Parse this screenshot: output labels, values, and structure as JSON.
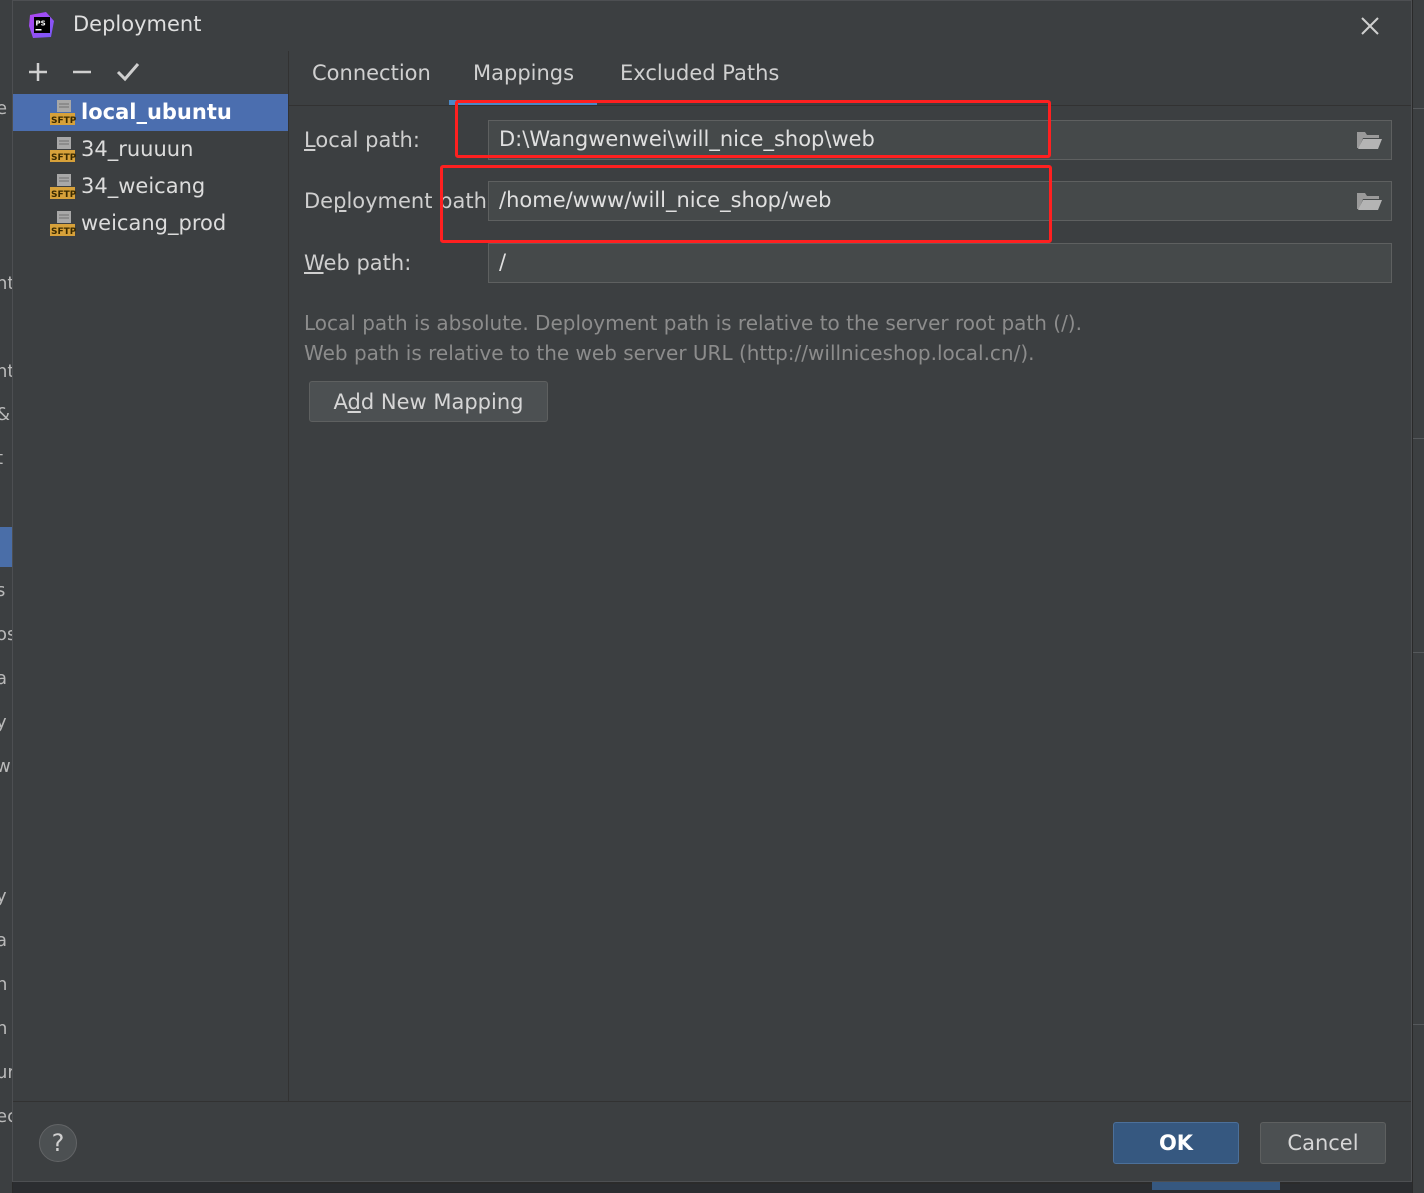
{
  "window": {
    "title": "Deployment",
    "app_icon_text": "PS"
  },
  "background_left_chars": [
    "e c",
    "nt",
    "nt",
    "&",
    "t",
    "s",
    "os",
    "a",
    "y",
    "w",
    "y",
    "a",
    "n",
    "n",
    "ur",
    "ec"
  ],
  "toolbar": {
    "add_icon": "plus-icon",
    "remove_icon": "minus-icon",
    "apply_icon": "check-icon"
  },
  "servers": [
    {
      "name": "local_ubuntu",
      "icon": "sftp-server-icon",
      "selected": true
    },
    {
      "name": "34_ruuuun",
      "icon": "sftp-server-icon",
      "selected": false
    },
    {
      "name": "34_weicang",
      "icon": "sftp-server-icon",
      "selected": false
    },
    {
      "name": "weicang_prod",
      "icon": "sftp-server-icon",
      "selected": false
    }
  ],
  "sftp_badge": "SFTP",
  "tabs": [
    {
      "label": "Connection",
      "active": false
    },
    {
      "label": "Mappings",
      "active": true
    },
    {
      "label": "Excluded Paths",
      "active": false
    }
  ],
  "mapping": {
    "local_path_label_mn": "L",
    "local_path_label_rest": "ocal path:",
    "local_path_value": "D:\\Wangwenwei\\will_nice_shop\\web",
    "deployment_path_label_pre": "De",
    "deployment_path_label_mn": "p",
    "deployment_path_label_rest": "loyment path:",
    "deployment_path_value": "/home/www/will_nice_shop/web",
    "web_path_label_mn": "W",
    "web_path_label_rest": "eb path:",
    "web_path_value": "/",
    "hint_line1": "Local path is absolute. Deployment path is relative to the server root path (/).",
    "hint_line2": "Web path is relative to the web server URL (http://willniceshop.local.cn/).",
    "add_button_pre": "A",
    "add_button_mn": "d",
    "add_button_rest": "d New Mapping"
  },
  "footer": {
    "help_label": "?",
    "ok_label": "OK",
    "cancel_label": "Cancel"
  },
  "colors": {
    "accent": "#4b6eaf",
    "ok_button": "#365880",
    "annotation": "#ff2020"
  }
}
